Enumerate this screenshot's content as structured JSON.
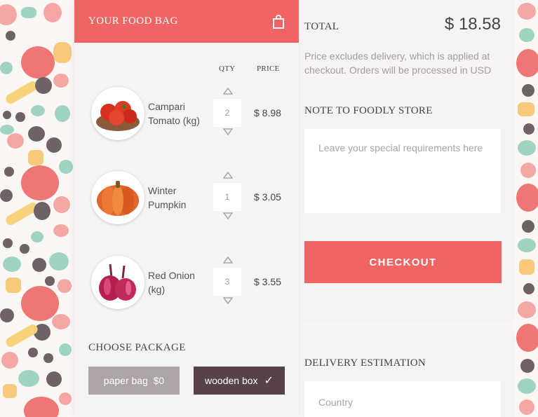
{
  "bag": {
    "title": "YOUR FOOD BAG",
    "icon": "shopping-bag-icon",
    "qty_header": "QTY",
    "price_header": "PRICE",
    "items": [
      {
        "name": "Campari Tomato (kg)",
        "qty": "2",
        "price": "$ 8.98",
        "image": "tomato-thumbnail"
      },
      {
        "name": "Winter Pumpkin",
        "qty": "1",
        "price": "$ 3.05",
        "image": "pumpkin-thumbnail"
      },
      {
        "name": "Red Onion (kg)",
        "qty": "3",
        "price": "$ 3.55",
        "image": "red-onion-thumbnail"
      }
    ],
    "package": {
      "title": "CHOOSE PACKAGE",
      "options": [
        {
          "label": "paper bag  $0",
          "selected": false
        },
        {
          "label": "wooden box",
          "selected": true,
          "check": "✓"
        }
      ]
    }
  },
  "summary": {
    "total_label": "TOTAL",
    "total_value": "$ 18.58",
    "note": "Price excludes delivery, which is applied at checkout. Orders will be processed in USD",
    "note_title": "NOTE TO FOODLY STORE",
    "note_placeholder": "Leave your special requirements here",
    "checkout_label": "CHECKOUT"
  },
  "delivery": {
    "title": "DELIVERY ESTIMATION",
    "country_placeholder": "Country"
  },
  "colors": {
    "accent": "#f06464",
    "dark": "#574347",
    "muted": "#aca4a6",
    "panel": "#f5f3f4"
  }
}
